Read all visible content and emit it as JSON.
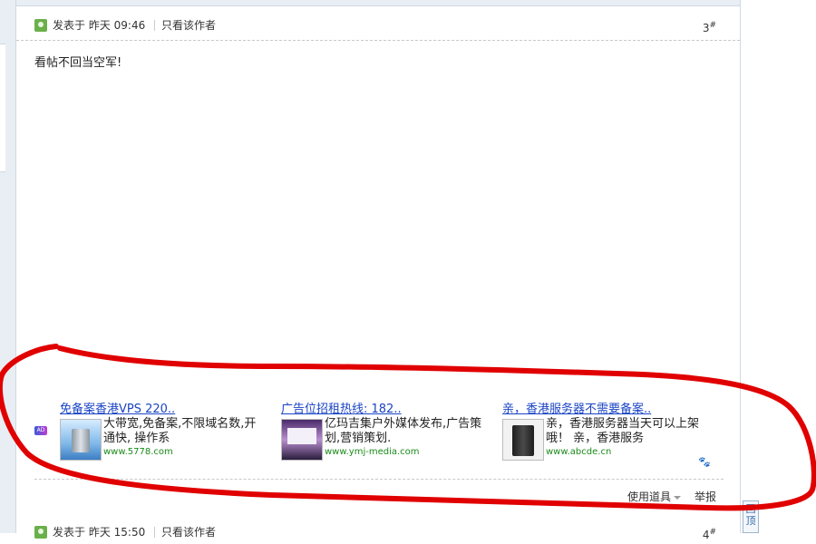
{
  "post": {
    "posted": "发表于 昨天 09:46",
    "only_author": "只看该作者",
    "floor": "3",
    "floor_mark": "#",
    "body": "看帖不回当空军!"
  },
  "ads": [
    {
      "title": "免备案香港VPS 220..",
      "desc": "大带宽,免备案,不限域名数,开通快, 操作系",
      "url": "www.5778.com",
      "thumb": "server-rack-image"
    },
    {
      "title": "广告位招租热线: 182..",
      "desc": "亿玛吉集户外媒体发布,广告策划,营销策划.",
      "url": "www.ymj-media.com",
      "thumb": "billboard-image"
    },
    {
      "title": "亲，香港服务器不需要备案..",
      "desc": "亲，香港服务器当天可以上架哦！ 亲，香港服务",
      "url": "www.abcde.cn",
      "thumb": "server-tower-image"
    }
  ],
  "ad_badge": "AD",
  "footer": {
    "use_tools": "使用道具",
    "report": "举报"
  },
  "next_post": {
    "posted": "发表于 昨天 15:50",
    "only_author": "只看该作者",
    "floor": "4",
    "floor_mark": "#"
  },
  "back_to_top": "回顶",
  "colors": {
    "link": "#1a44c4",
    "url_green": "#1a8a1a",
    "annotation_red": "#e00000",
    "border": "#cfd9e3"
  },
  "icons": {
    "user": "user-icon",
    "paw": "paw-icon",
    "caret": "caret-down-icon"
  }
}
